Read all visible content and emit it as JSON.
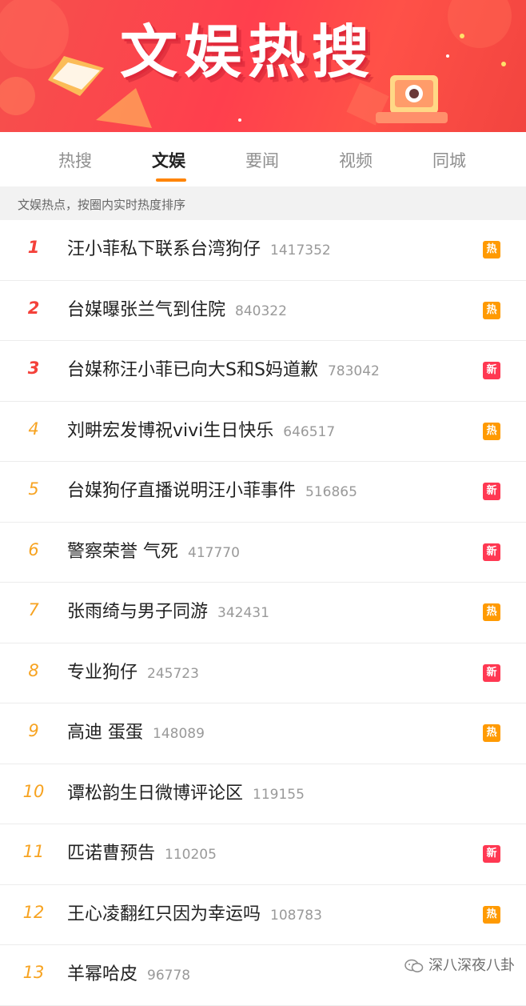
{
  "banner": {
    "title": "文娱热搜"
  },
  "tabs": [
    {
      "label": "热搜",
      "active": false
    },
    {
      "label": "文娱",
      "active": true
    },
    {
      "label": "要闻",
      "active": false
    },
    {
      "label": "视频",
      "active": false
    },
    {
      "label": "同城",
      "active": false
    }
  ],
  "subtitle": "文娱热点，按圈内实时热度排序",
  "items": [
    {
      "rank": "1",
      "topic": "汪小菲私下联系台湾狗仔",
      "count": "1417352",
      "badge": "热",
      "badge_type": "hot"
    },
    {
      "rank": "2",
      "topic": "台媒曝张兰气到住院",
      "count": "840322",
      "badge": "热",
      "badge_type": "hot"
    },
    {
      "rank": "3",
      "topic": "台媒称汪小菲已向大S和S妈道歉",
      "count": "783042",
      "badge": "新",
      "badge_type": "new"
    },
    {
      "rank": "4",
      "topic": "刘畊宏发博祝vivi生日快乐",
      "count": "646517",
      "badge": "热",
      "badge_type": "hot"
    },
    {
      "rank": "5",
      "topic": "台媒狗仔直播说明汪小菲事件",
      "count": "516865",
      "badge": "新",
      "badge_type": "new"
    },
    {
      "rank": "6",
      "topic": "警察荣誉 气死",
      "count": "417770",
      "badge": "新",
      "badge_type": "new"
    },
    {
      "rank": "7",
      "topic": "张雨绮与男子同游",
      "count": "342431",
      "badge": "热",
      "badge_type": "hot"
    },
    {
      "rank": "8",
      "topic": "专业狗仔",
      "count": "245723",
      "badge": "新",
      "badge_type": "new"
    },
    {
      "rank": "9",
      "topic": "高迪 蛋蛋",
      "count": "148089",
      "badge": "热",
      "badge_type": "hot"
    },
    {
      "rank": "10",
      "topic": "谭松韵生日微博评论区",
      "count": "119155",
      "badge": "",
      "badge_type": ""
    },
    {
      "rank": "11",
      "topic": "匹诺曹预告",
      "count": "110205",
      "badge": "新",
      "badge_type": "new"
    },
    {
      "rank": "12",
      "topic": "王心凌翻红只因为幸运吗",
      "count": "108783",
      "badge": "热",
      "badge_type": "hot"
    },
    {
      "rank": "13",
      "topic": "羊幂哈皮",
      "count": "96778",
      "badge": "",
      "badge_type": ""
    }
  ],
  "watermark": {
    "text": "深八深夜八卦"
  },
  "colors": {
    "top3": "#f4413a",
    "rank": "#f7a321",
    "hot": "#ff9a02",
    "new": "#ff3852",
    "tab_underline": "#ff8400"
  }
}
